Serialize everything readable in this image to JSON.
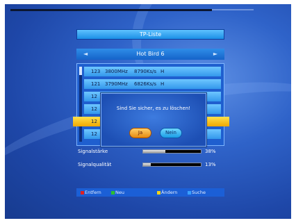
{
  "panel": {
    "title": "TP-Liste",
    "satellite": "Hot Bird 6",
    "arrow_left": "◄",
    "arrow_right": "►"
  },
  "transponders": [
    {
      "num": "123",
      "freq": "3800MHz",
      "sr": "8790Ks/s",
      "pol": "H"
    },
    {
      "num": "121",
      "freq": "3790MHz",
      "sr": "6826Ks/s",
      "pol": "H"
    },
    {
      "num": "12",
      "freq": "",
      "sr": "",
      "pol": ""
    },
    {
      "num": "12",
      "freq": "",
      "sr": "",
      "pol": ""
    },
    {
      "num": "12",
      "freq": "",
      "sr": "",
      "pol": "",
      "selected": true
    },
    {
      "num": "12",
      "freq": "",
      "sr": "",
      "pol": ""
    }
  ],
  "signal": {
    "strength_label": "Signalstärke",
    "strength_value": 38,
    "strength_text": "38%",
    "quality_label": "Signalqualität",
    "quality_value": 13,
    "quality_text": "13%"
  },
  "legend": {
    "red": "Entfern",
    "green": "Neu",
    "yellow": "Ändern",
    "blue": "Suche"
  },
  "dialog": {
    "message": "Sind Sie sicher, es zu löschen!",
    "yes": "Ja",
    "no": "Nein"
  },
  "colors": {
    "red_key": "#e02020",
    "green_key": "#2ec02e",
    "yellow_key": "#f2d21a",
    "blue_key": "#39a0ff"
  }
}
